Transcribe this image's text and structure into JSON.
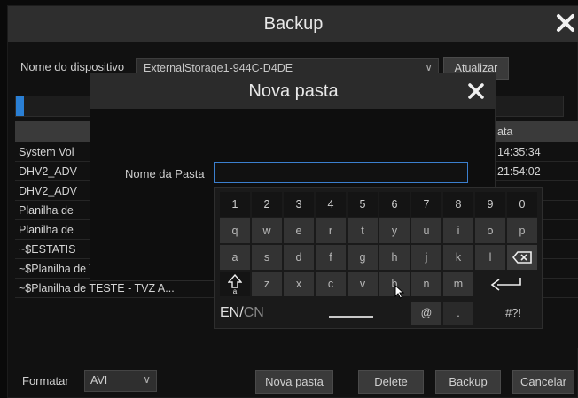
{
  "backup": {
    "title": "Backup",
    "device_label": "Nome do dispositivo",
    "device_value": "ExternalStorage1-944C-D4DE",
    "refresh_label": "Atualizar",
    "progress": 0.014,
    "table": {
      "date_header": "ata",
      "rows": [
        {
          "name": "System Vol",
          "time": "14:35:34"
        },
        {
          "name": "DHV2_ADV",
          "time": "21:54:02"
        },
        {
          "name": "DHV2_ADV",
          "time": ""
        },
        {
          "name": "Planilha de",
          "time": ""
        },
        {
          "name": "Planilha de",
          "time": ""
        },
        {
          "name": "~$ESTATIS",
          "time": ""
        },
        {
          "name": "~$Planilha de TESTE - TVZ A...",
          "time": ""
        },
        {
          "name": "~$Planilha de TESTE - TVZ A...",
          "time": ""
        }
      ]
    },
    "format_label": "Formatar",
    "format_value": "AVI",
    "buttons": {
      "new_folder": "Nova pasta",
      "delete": "Delete",
      "backup": "Backup",
      "cancel": "Cancelar"
    }
  },
  "dialog": {
    "title": "Nova pasta",
    "folder_label": "Nome da Pasta",
    "folder_value": ""
  },
  "keyboard": {
    "row1": [
      "1",
      "2",
      "3",
      "4",
      "5",
      "6",
      "7",
      "8",
      "9",
      "0"
    ],
    "row2": [
      "q",
      "w",
      "e",
      "r",
      "t",
      "y",
      "u",
      "i",
      "o",
      "p"
    ],
    "row3": [
      "a",
      "s",
      "d",
      "f",
      "g",
      "h",
      "j",
      "k",
      "l"
    ],
    "row4": [
      "z",
      "x",
      "c",
      "v",
      "b",
      "n",
      "m"
    ],
    "shift_icon": "shift-icon",
    "backspace_icon": "backspace-icon",
    "enter_icon": "enter-icon",
    "lang_active": "EN",
    "lang_sep": "/",
    "lang_other": "CN",
    "at": "@",
    "dot": ".",
    "symbols": "#?!"
  },
  "colors": {
    "accent": "#2a7fd4",
    "titlebar": "#2e2e2e",
    "background": "#111111"
  }
}
